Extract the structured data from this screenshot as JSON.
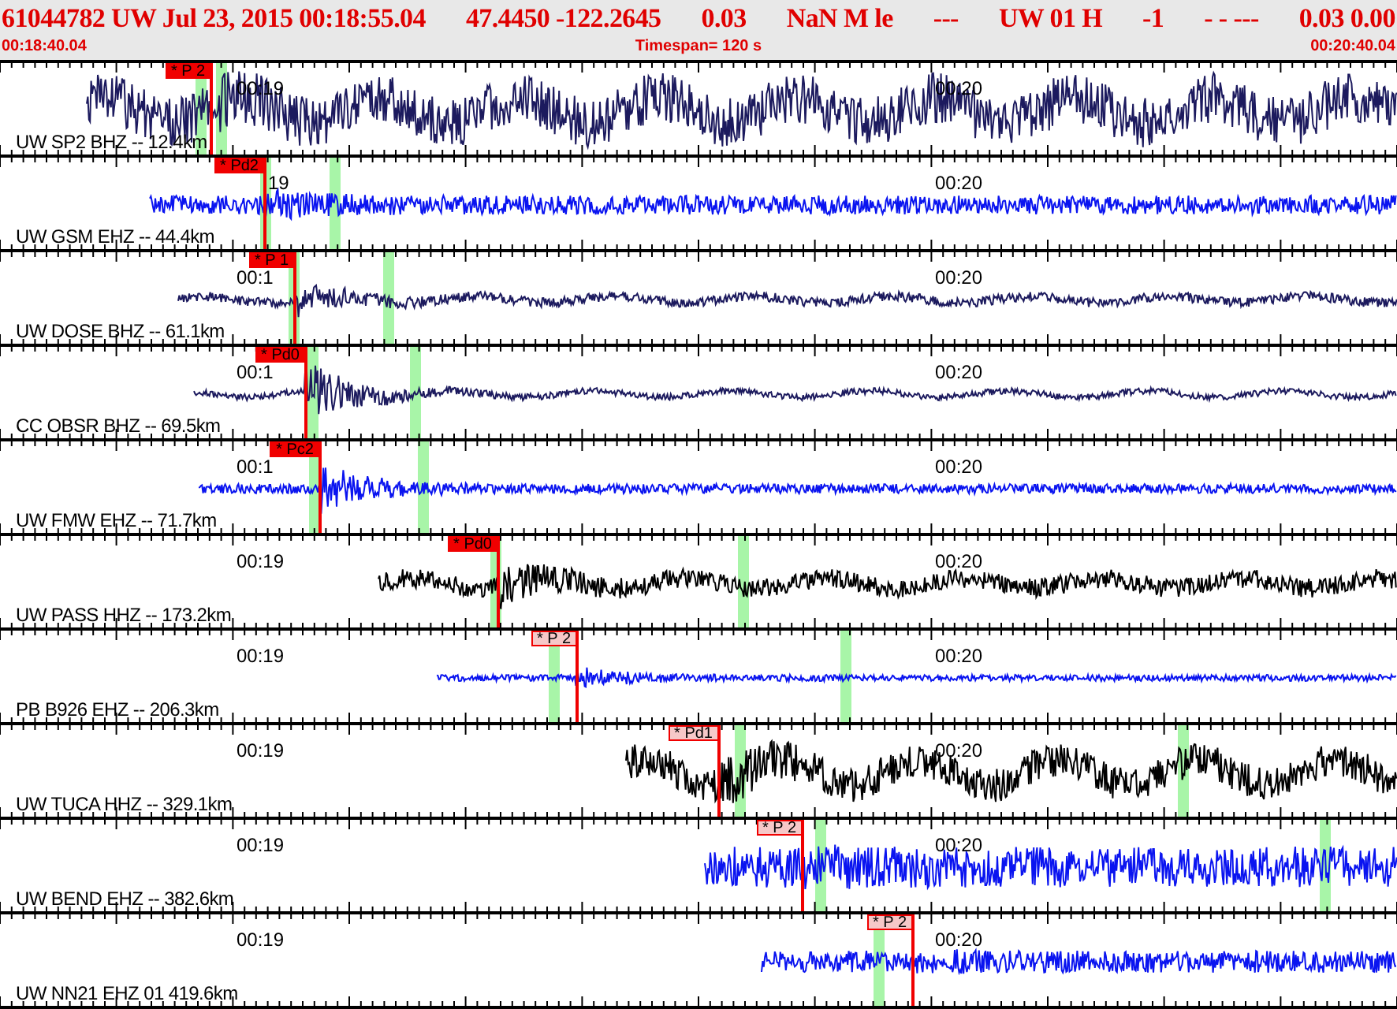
{
  "header": {
    "fields": [
      "61044782 UW Jul 23, 2015 00:18:55.04",
      "47.4450 -122.2645",
      "0.03",
      "NaN M  le",
      "---",
      "UW 01 H",
      "-1",
      "-  - ---",
      "0.03 0.00"
    ],
    "start_time": "00:18:40.04",
    "timespan": "Timespan= 120 s",
    "end_time": "00:20:40.04"
  },
  "traces": [
    {
      "label": "UW SP2 BHZ -- 12.4km",
      "color": "#1c1a5e",
      "pick": "* P 2",
      "pick_filled": true,
      "time_labels": [
        "00:19",
        "00:20"
      ]
    },
    {
      "label": "UW GSM EHZ -- 44.4km",
      "color": "#0a14f0",
      "pick": "* Pd2",
      "pick_filled": true,
      "time_labels": [
        "19",
        "00:20"
      ]
    },
    {
      "label": "UW DOSE BHZ -- 61.1km",
      "color": "#1c1a5e",
      "pick": "* P 1",
      "pick_filled": true,
      "time_labels": [
        "00:1",
        "00:20"
      ]
    },
    {
      "label": "CC OBSR BHZ -- 69.5km",
      "color": "#1c1a5e",
      "pick": "* Pd0",
      "pick_filled": true,
      "time_labels": [
        "00:1",
        "00:20"
      ]
    },
    {
      "label": "UW FMW EHZ -- 71.7km",
      "color": "#0a14f0",
      "pick": "* Pc2",
      "pick_filled": true,
      "time_labels": [
        "00:1",
        "00:20"
      ]
    },
    {
      "label": "UW PASS HHZ -- 173.2km",
      "color": "#000000",
      "pick": "* Pd0",
      "pick_filled": true,
      "time_labels": [
        "00:19",
        "00:20"
      ]
    },
    {
      "label": "PB B926 EHZ -- 206.3km",
      "color": "#0a14f0",
      "pick": "* P 2",
      "pick_filled": false,
      "time_labels": [
        "00:19",
        "00:20"
      ]
    },
    {
      "label": "UW TUCA HHZ -- 329.1km",
      "color": "#000000",
      "pick": "* Pd1",
      "pick_filled": false,
      "time_labels": [
        "00:19",
        "00:20"
      ]
    },
    {
      "label": "UW BEND EHZ -- 382.6km",
      "color": "#0a14f0",
      "pick": "* P 2",
      "pick_filled": false,
      "time_labels": [
        "00:19",
        "00:20"
      ]
    },
    {
      "label": "UW NN21 EHZ 01 419.6km",
      "color": "#0a14f0",
      "pick": "* P 2",
      "pick_filled": false,
      "time_labels": [
        "00:19",
        "00:20"
      ]
    }
  ]
}
